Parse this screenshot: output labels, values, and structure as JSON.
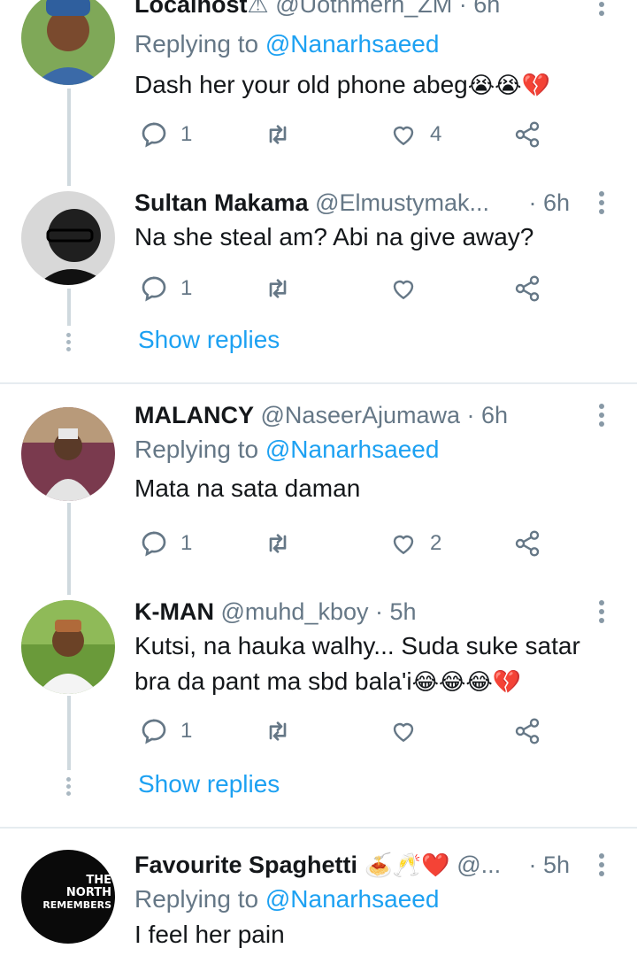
{
  "tweets": [
    {
      "name": "Localhost",
      "name_suffix": "⚠",
      "handle": "@Uothmern_ZM",
      "time": "· 6h",
      "reply_prefix": "Replying to",
      "reply_to": "@Nanarhsaeed",
      "text": "Dash her your old phone abeg",
      "emojis": "😭😭💔",
      "replies": "1",
      "retweets": "",
      "likes": "4"
    },
    {
      "name": "Sultan Makama",
      "handle": "@Elmustymak...",
      "time": "· 6h",
      "text": "Na she steal am? Abi na give away?",
      "replies": "1",
      "retweets": "",
      "likes": "",
      "show_replies": "Show replies"
    },
    {
      "name": "MALANCY",
      "handle": "@NaseerAjumawa",
      "time": "· 6h",
      "reply_prefix": "Replying to",
      "reply_to": "@Nanarhsaeed",
      "text": "Mata na sata daman",
      "replies": "1",
      "retweets": "",
      "likes": "2"
    },
    {
      "name": "K-MAN",
      "handle": "@muhd_kboy",
      "time": "· 5h",
      "text_line1": "Kutsi, na hauka walhy... Suda suke satar",
      "text_line2": "bra da pant ma sbd bala'i",
      "emojis": "😂😂😂💔",
      "replies": "1",
      "retweets": "",
      "likes": "",
      "show_replies": "Show replies"
    },
    {
      "name": "Favourite Spaghetti",
      "name_emojis": "🍝🥂❤️",
      "handle": "@...",
      "time": "· 5h",
      "reply_prefix": "Replying to",
      "reply_to": "@Nanarhsaeed",
      "text": "I feel her pain",
      "avatar_text_line1": "THE",
      "avatar_text_line2": "NORTH",
      "avatar_text_line3": "REMEMBERS"
    }
  ],
  "colors": {
    "accent": "#1da1f2",
    "text": "#14171a",
    "secondary": "#657786",
    "divider": "#e6ecf0",
    "thread_line": "#cfd9de"
  },
  "icons": [
    "reply-icon",
    "retweet-icon",
    "like-icon",
    "share-icon",
    "more-icon"
  ]
}
